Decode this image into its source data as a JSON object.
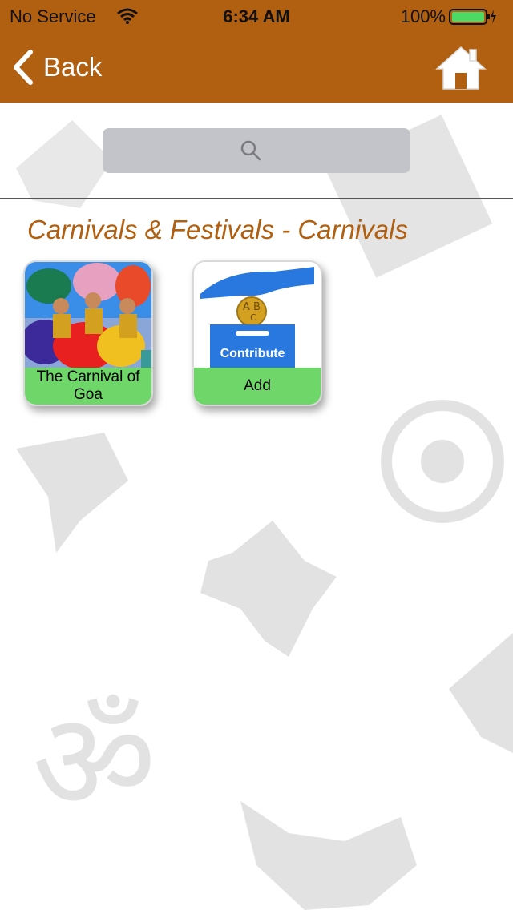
{
  "status_bar": {
    "carrier": "No Service",
    "time": "6:34 AM",
    "battery": "100%"
  },
  "nav": {
    "back_label": "Back"
  },
  "search": {
    "placeholder": ""
  },
  "section": {
    "title": "Carnivals & Festivals - Carnivals"
  },
  "items": [
    {
      "label": "The Carnival of Goa",
      "image": "carnival-photo"
    },
    {
      "label": "Add",
      "image": "contribute-graphic",
      "image_text": "Contribute",
      "coin_text": "ABC"
    }
  ],
  "colors": {
    "header": "#b15f10",
    "accent_text": "#b15f10",
    "card_label_bg": "#6fd66a",
    "contribute_blue": "#2878e0"
  }
}
